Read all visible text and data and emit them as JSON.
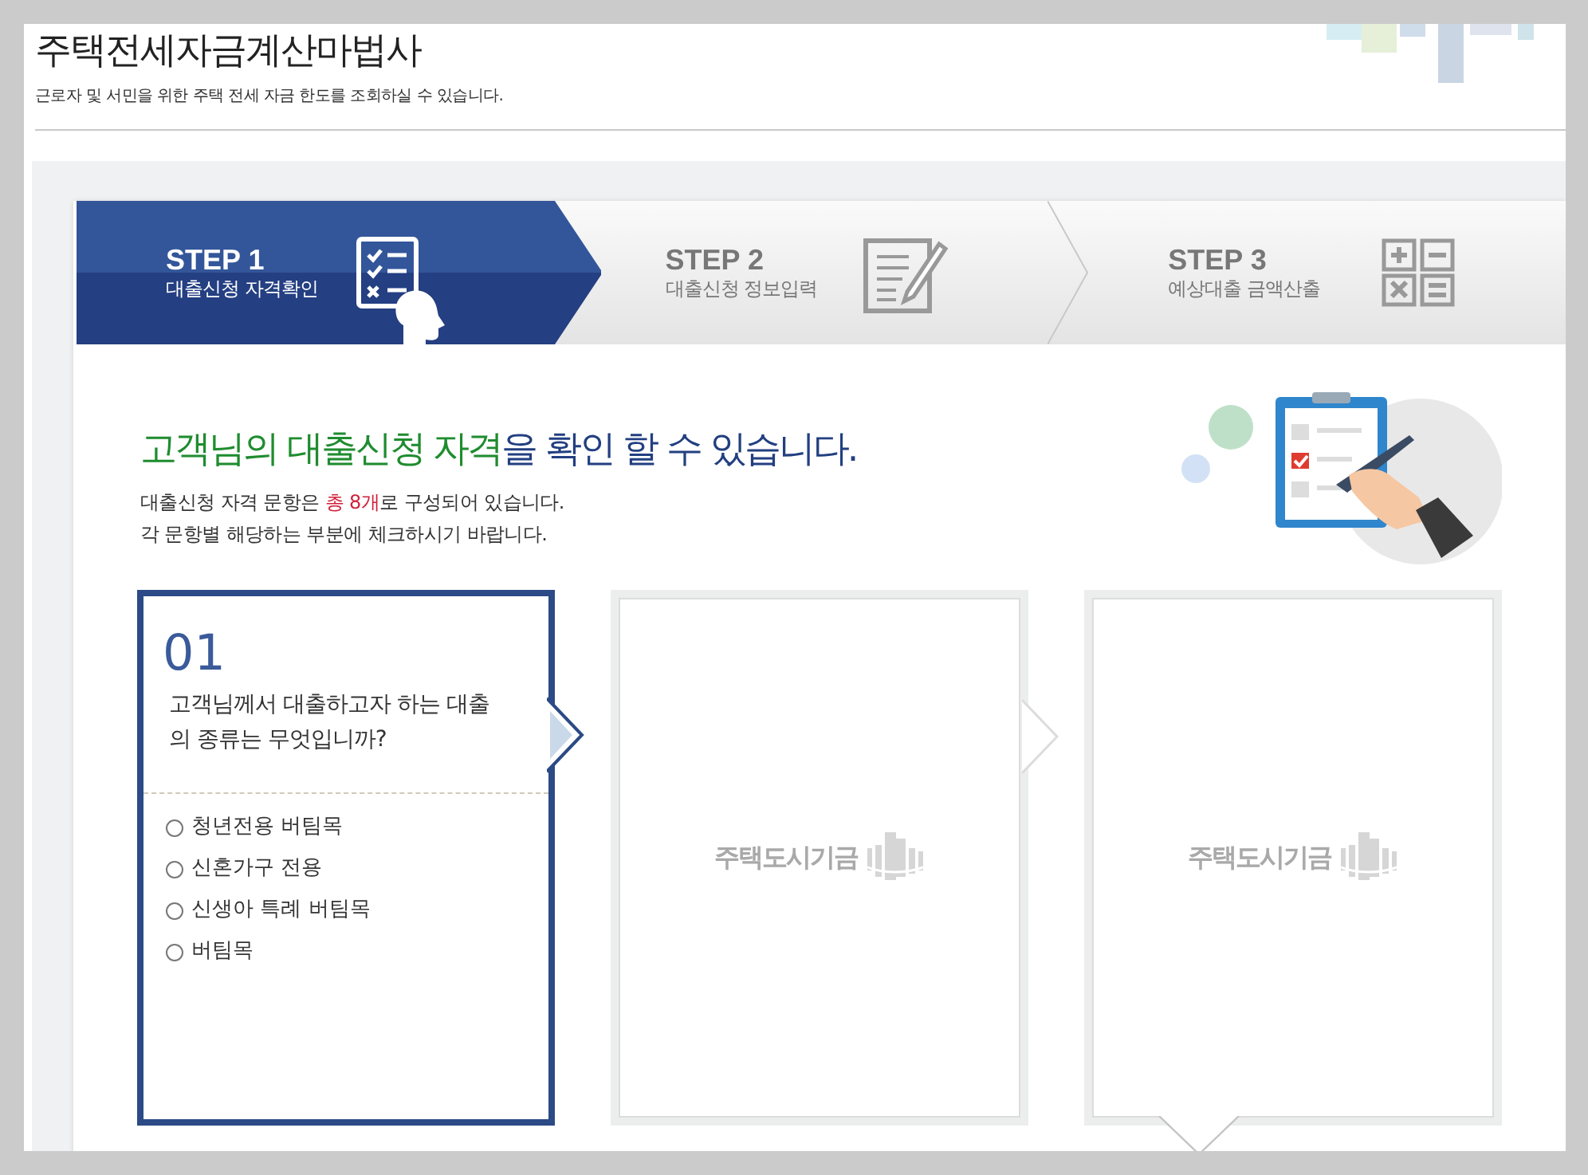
{
  "page": {
    "title": "주택전세자금계산마법사",
    "subtitle": "근로자 및 서민을 위한 주택 전세 자금 한도를 조회하실 수 있습니다."
  },
  "steps": [
    {
      "label": "STEP 1",
      "caption": "대출신청 자격확인",
      "kind": "person",
      "selected": true
    },
    {
      "label": "STEP 2",
      "caption": "대출신청 정보입력",
      "kind": "form",
      "selected": false
    },
    {
      "label": "STEP 3",
      "caption": "예상대출 금액산출",
      "kind": "calculator",
      "selected": false
    }
  ],
  "intro": {
    "heading_highlight": "고객님의 대출신청 자격",
    "heading_rest": "을 확인 할 수 있습니다.",
    "line_1_start": "대출신청 자격 문항은 ",
    "line_1_highlight": "총 8개",
    "line_1_end": "로 구성되어 있습니다.",
    "line_2": "각 문항별 해당하는 부분에 체크하시기 바랍니다."
  },
  "questions": [
    {
      "selected": true,
      "number": "01",
      "text": "고객님께서 대출하고자 하는 대출의 종류는 무엇입니까?",
      "options": [
        {
          "label": "청년전용 버팀목",
          "selected": false
        },
        {
          "label": "신혼가구 전용",
          "selected": false
        },
        {
          "label": "신생아 특례 버팀목",
          "selected": false
        },
        {
          "label": "버팀목",
          "selected": false
        }
      ]
    },
    {
      "selected": false,
      "placeholder": "주택도시기금"
    },
    {
      "selected": false,
      "placeholder": "주택도시기금"
    }
  ]
}
